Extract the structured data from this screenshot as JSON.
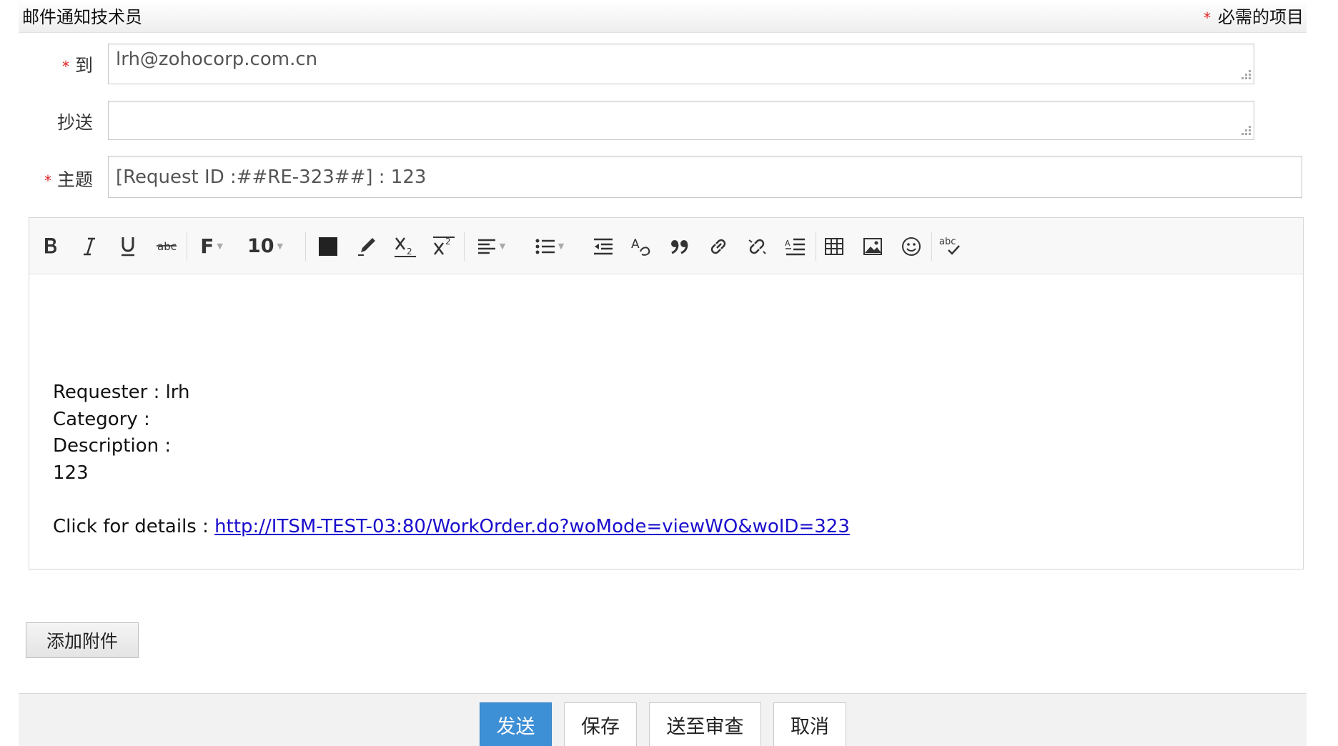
{
  "header": {
    "title": "邮件通知技术员",
    "required_marker": "*",
    "required_note": "必需的项目"
  },
  "form": {
    "to": {
      "required_marker": "*",
      "label": "到",
      "value": "lrh@zohocorp.com.cn"
    },
    "cc": {
      "label": "抄送",
      "value": ""
    },
    "subject": {
      "required_marker": "*",
      "label": "主题",
      "value": "[Request ID :##RE-323##] : 123"
    }
  },
  "toolbar": {
    "font_family_label": "F",
    "font_size_value": "10",
    "text_color": "#222222",
    "icons": [
      "bold-icon",
      "italic-icon",
      "underline-icon",
      "strikethrough-icon",
      "font-family-icon",
      "font-size-select",
      "text-color-icon",
      "highlight-icon",
      "subscript-icon",
      "superscript-icon",
      "align-icon",
      "list-icon",
      "outdent-icon",
      "clear-format-icon",
      "quote-icon",
      "link-icon",
      "unlink-icon",
      "line-height-icon",
      "table-icon",
      "image-icon",
      "emoji-icon",
      "spellcheck-icon"
    ]
  },
  "editor": {
    "lines": [
      "Requester : lrh",
      "Category :",
      "Description :",
      "123"
    ],
    "details_prefix": "Click for details : ",
    "details_link": "http://ITSM-TEST-03:80/WorkOrder.do?woMode=viewWO&woID=323"
  },
  "attach_button": "添加附件",
  "footer": {
    "send": "发送",
    "save": "保存",
    "submit_review": "送至审查",
    "cancel": "取消"
  },
  "colors": {
    "primary_button": "#3d8fd6",
    "required_star": "#e02020",
    "link": "#1a0dcc"
  }
}
